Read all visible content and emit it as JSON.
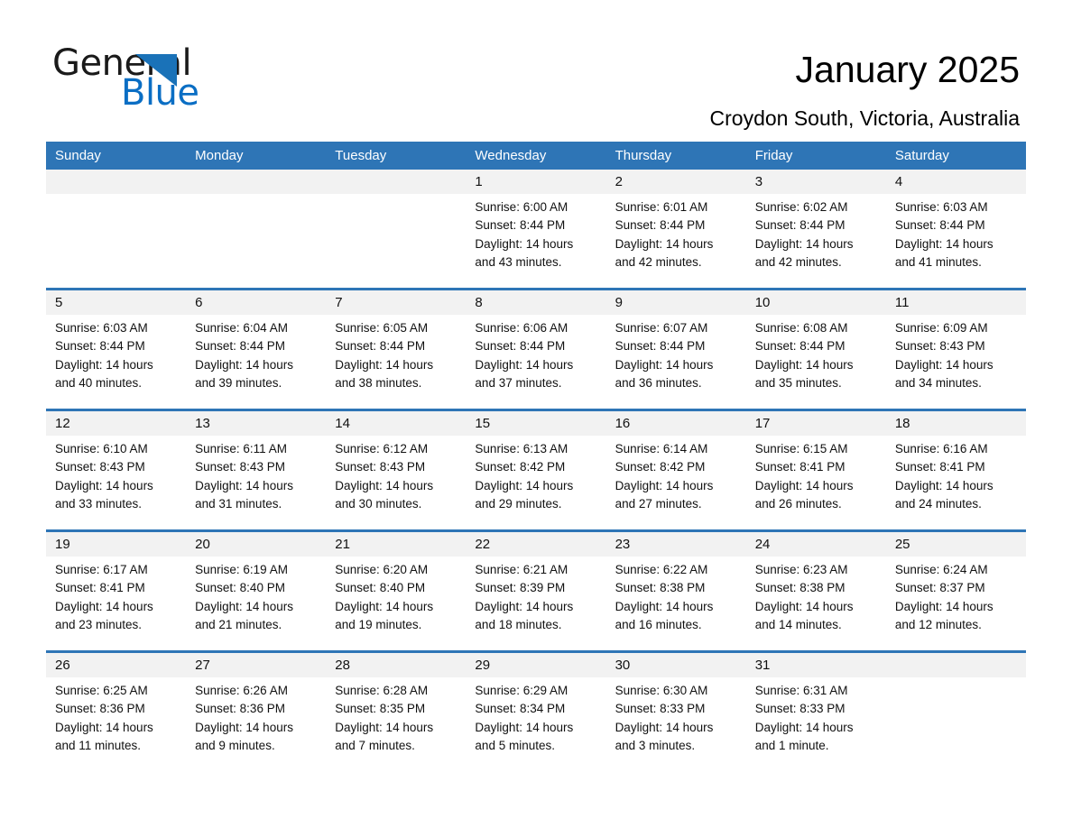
{
  "brand": {
    "word_general": "General",
    "word_blue": "Blue",
    "triangle_color": "#1a72b8",
    "blue_color": "#0a6ec4"
  },
  "header": {
    "title": "January 2025",
    "subtitle": "Croydon South, Victoria, Australia"
  },
  "theme": {
    "header_blue": "#2e75b6",
    "daynum_band": "#f2f2f2",
    "text": "#111111"
  },
  "calendar": {
    "weekdays": [
      "Sunday",
      "Monday",
      "Tuesday",
      "Wednesday",
      "Thursday",
      "Friday",
      "Saturday"
    ],
    "weeks": [
      {
        "daynums": [
          "",
          "",
          "",
          "1",
          "2",
          "3",
          "4"
        ],
        "cells": [
          {
            "lines": []
          },
          {
            "lines": []
          },
          {
            "lines": []
          },
          {
            "lines": [
              "Sunrise: 6:00 AM",
              "Sunset: 8:44 PM",
              "Daylight: 14 hours",
              "and 43 minutes."
            ]
          },
          {
            "lines": [
              "Sunrise: 6:01 AM",
              "Sunset: 8:44 PM",
              "Daylight: 14 hours",
              "and 42 minutes."
            ]
          },
          {
            "lines": [
              "Sunrise: 6:02 AM",
              "Sunset: 8:44 PM",
              "Daylight: 14 hours",
              "and 42 minutes."
            ]
          },
          {
            "lines": [
              "Sunrise: 6:03 AM",
              "Sunset: 8:44 PM",
              "Daylight: 14 hours",
              "and 41 minutes."
            ]
          }
        ]
      },
      {
        "daynums": [
          "5",
          "6",
          "7",
          "8",
          "9",
          "10",
          "11"
        ],
        "cells": [
          {
            "lines": [
              "Sunrise: 6:03 AM",
              "Sunset: 8:44 PM",
              "Daylight: 14 hours",
              "and 40 minutes."
            ]
          },
          {
            "lines": [
              "Sunrise: 6:04 AM",
              "Sunset: 8:44 PM",
              "Daylight: 14 hours",
              "and 39 minutes."
            ]
          },
          {
            "lines": [
              "Sunrise: 6:05 AM",
              "Sunset: 8:44 PM",
              "Daylight: 14 hours",
              "and 38 minutes."
            ]
          },
          {
            "lines": [
              "Sunrise: 6:06 AM",
              "Sunset: 8:44 PM",
              "Daylight: 14 hours",
              "and 37 minutes."
            ]
          },
          {
            "lines": [
              "Sunrise: 6:07 AM",
              "Sunset: 8:44 PM",
              "Daylight: 14 hours",
              "and 36 minutes."
            ]
          },
          {
            "lines": [
              "Sunrise: 6:08 AM",
              "Sunset: 8:44 PM",
              "Daylight: 14 hours",
              "and 35 minutes."
            ]
          },
          {
            "lines": [
              "Sunrise: 6:09 AM",
              "Sunset: 8:43 PM",
              "Daylight: 14 hours",
              "and 34 minutes."
            ]
          }
        ]
      },
      {
        "daynums": [
          "12",
          "13",
          "14",
          "15",
          "16",
          "17",
          "18"
        ],
        "cells": [
          {
            "lines": [
              "Sunrise: 6:10 AM",
              "Sunset: 8:43 PM",
              "Daylight: 14 hours",
              "and 33 minutes."
            ]
          },
          {
            "lines": [
              "Sunrise: 6:11 AM",
              "Sunset: 8:43 PM",
              "Daylight: 14 hours",
              "and 31 minutes."
            ]
          },
          {
            "lines": [
              "Sunrise: 6:12 AM",
              "Sunset: 8:43 PM",
              "Daylight: 14 hours",
              "and 30 minutes."
            ]
          },
          {
            "lines": [
              "Sunrise: 6:13 AM",
              "Sunset: 8:42 PM",
              "Daylight: 14 hours",
              "and 29 minutes."
            ]
          },
          {
            "lines": [
              "Sunrise: 6:14 AM",
              "Sunset: 8:42 PM",
              "Daylight: 14 hours",
              "and 27 minutes."
            ]
          },
          {
            "lines": [
              "Sunrise: 6:15 AM",
              "Sunset: 8:41 PM",
              "Daylight: 14 hours",
              "and 26 minutes."
            ]
          },
          {
            "lines": [
              "Sunrise: 6:16 AM",
              "Sunset: 8:41 PM",
              "Daylight: 14 hours",
              "and 24 minutes."
            ]
          }
        ]
      },
      {
        "daynums": [
          "19",
          "20",
          "21",
          "22",
          "23",
          "24",
          "25"
        ],
        "cells": [
          {
            "lines": [
              "Sunrise: 6:17 AM",
              "Sunset: 8:41 PM",
              "Daylight: 14 hours",
              "and 23 minutes."
            ]
          },
          {
            "lines": [
              "Sunrise: 6:19 AM",
              "Sunset: 8:40 PM",
              "Daylight: 14 hours",
              "and 21 minutes."
            ]
          },
          {
            "lines": [
              "Sunrise: 6:20 AM",
              "Sunset: 8:40 PM",
              "Daylight: 14 hours",
              "and 19 minutes."
            ]
          },
          {
            "lines": [
              "Sunrise: 6:21 AM",
              "Sunset: 8:39 PM",
              "Daylight: 14 hours",
              "and 18 minutes."
            ]
          },
          {
            "lines": [
              "Sunrise: 6:22 AM",
              "Sunset: 8:38 PM",
              "Daylight: 14 hours",
              "and 16 minutes."
            ]
          },
          {
            "lines": [
              "Sunrise: 6:23 AM",
              "Sunset: 8:38 PM",
              "Daylight: 14 hours",
              "and 14 minutes."
            ]
          },
          {
            "lines": [
              "Sunrise: 6:24 AM",
              "Sunset: 8:37 PM",
              "Daylight: 14 hours",
              "and 12 minutes."
            ]
          }
        ]
      },
      {
        "daynums": [
          "26",
          "27",
          "28",
          "29",
          "30",
          "31",
          ""
        ],
        "cells": [
          {
            "lines": [
              "Sunrise: 6:25 AM",
              "Sunset: 8:36 PM",
              "Daylight: 14 hours",
              "and 11 minutes."
            ]
          },
          {
            "lines": [
              "Sunrise: 6:26 AM",
              "Sunset: 8:36 PM",
              "Daylight: 14 hours",
              "and 9 minutes."
            ]
          },
          {
            "lines": [
              "Sunrise: 6:28 AM",
              "Sunset: 8:35 PM",
              "Daylight: 14 hours",
              "and 7 minutes."
            ]
          },
          {
            "lines": [
              "Sunrise: 6:29 AM",
              "Sunset: 8:34 PM",
              "Daylight: 14 hours",
              "and 5 minutes."
            ]
          },
          {
            "lines": [
              "Sunrise: 6:30 AM",
              "Sunset: 8:33 PM",
              "Daylight: 14 hours",
              "and 3 minutes."
            ]
          },
          {
            "lines": [
              "Sunrise: 6:31 AM",
              "Sunset: 8:33 PM",
              "Daylight: 14 hours",
              "and 1 minute."
            ]
          },
          {
            "lines": []
          }
        ]
      }
    ]
  }
}
